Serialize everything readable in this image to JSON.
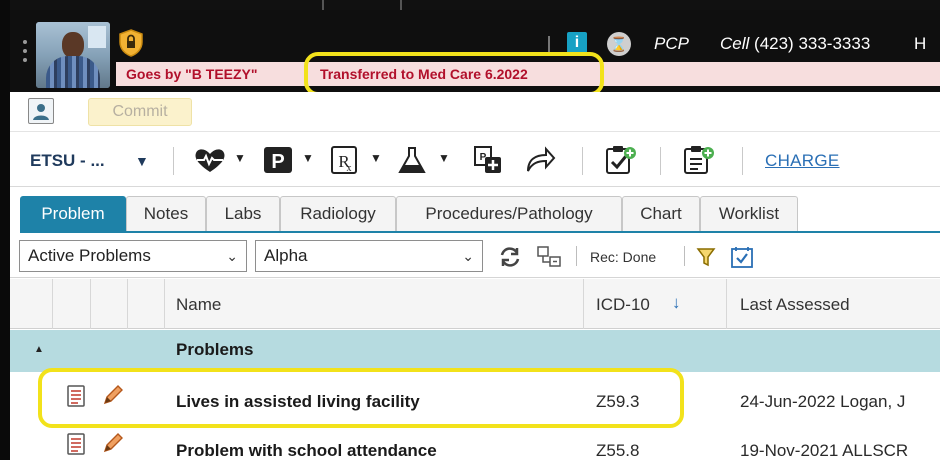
{
  "patient": {
    "alerts": [
      {
        "text": "Goes by \"B TEEZY\""
      },
      {
        "text": "Transferred to Med Care 6.2022"
      }
    ],
    "pcp_label": "PCP",
    "cell_label": "Cell",
    "cell_number": "(423) 333-3333",
    "header_trailing": "H"
  },
  "commit_bar": {
    "commit_label": "Commit"
  },
  "toolbar": {
    "org_label": "ETSU - ...",
    "charge_label": "CHARGE",
    "icons": [
      "heart-rate-icon",
      "p-icon",
      "rx-icon",
      "flask-icon",
      "document-plus-icon",
      "forward-arrow-icon",
      "clipboard-check-icon",
      "note-add-icon"
    ]
  },
  "tabs": [
    {
      "label": "Problem",
      "active": true
    },
    {
      "label": "Notes",
      "active": false
    },
    {
      "label": "Labs",
      "active": false
    },
    {
      "label": "Radiology",
      "active": false
    },
    {
      "label": "Procedures/Pathology",
      "active": false
    },
    {
      "label": "Chart",
      "active": false
    },
    {
      "label": "Worklist",
      "active": false
    }
  ],
  "filters": {
    "status_select": "Active Problems",
    "sort_select": "Alpha",
    "rec_label": "Rec: Done"
  },
  "table": {
    "columns": {
      "name": "Name",
      "icd": "ICD-10",
      "last_assessed": "Last Assessed"
    },
    "group_label": "Problems",
    "rows": [
      {
        "name": "Lives in assisted living facility",
        "icd": "Z59.3",
        "last_assessed": "24-Jun-2022 Logan, J"
      },
      {
        "name": "Problem with school attendance",
        "icd": "Z55.8",
        "last_assessed": "19-Nov-2021 ALLSCR"
      }
    ]
  },
  "colors": {
    "accent": "#1e82a8",
    "alert_text": "#b1102b",
    "highlight": "#f2e21b",
    "group_row": "#b6dbe0"
  }
}
